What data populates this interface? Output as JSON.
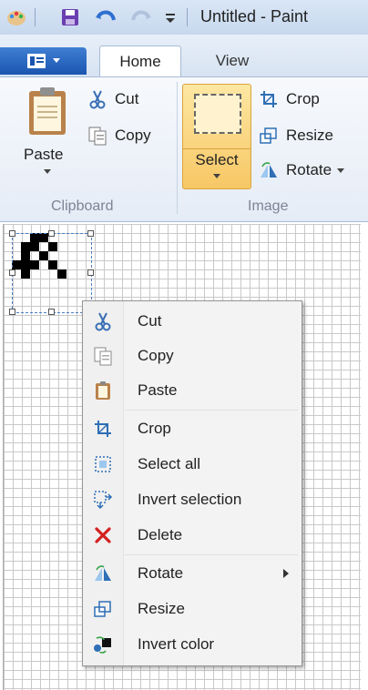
{
  "window": {
    "title": "Untitled - Paint"
  },
  "tabs": [
    {
      "label": "Home"
    },
    {
      "label": "View"
    }
  ],
  "ribbon": {
    "clipboard": {
      "group_label": "Clipboard",
      "paste_label": "Paste",
      "cut_label": "Cut",
      "copy_label": "Copy"
    },
    "image": {
      "group_label": "Image",
      "select_label": "Select",
      "crop_label": "Crop",
      "resize_label": "Resize",
      "rotate_label": "Rotate"
    }
  },
  "context_menu": {
    "items": [
      {
        "label": "Cut",
        "icon": "cut-icon"
      },
      {
        "label": "Copy",
        "icon": "copy-icon"
      },
      {
        "label": "Paste",
        "icon": "paste-icon"
      },
      {
        "label": "Crop",
        "icon": "crop-icon"
      },
      {
        "label": "Select all",
        "icon": "select-all-icon"
      },
      {
        "label": "Invert selection",
        "icon": "invert-selection-icon"
      },
      {
        "label": "Delete",
        "icon": "delete-icon"
      },
      {
        "label": "Rotate",
        "icon": "rotate-icon"
      },
      {
        "label": "Resize",
        "icon": "resize-icon"
      },
      {
        "label": "Invert color",
        "icon": "invert-color-icon"
      }
    ]
  },
  "colors": {
    "accent_blue": "#1b55b0",
    "select_highlight": "#f7c765",
    "delete_red": "#d42020"
  }
}
